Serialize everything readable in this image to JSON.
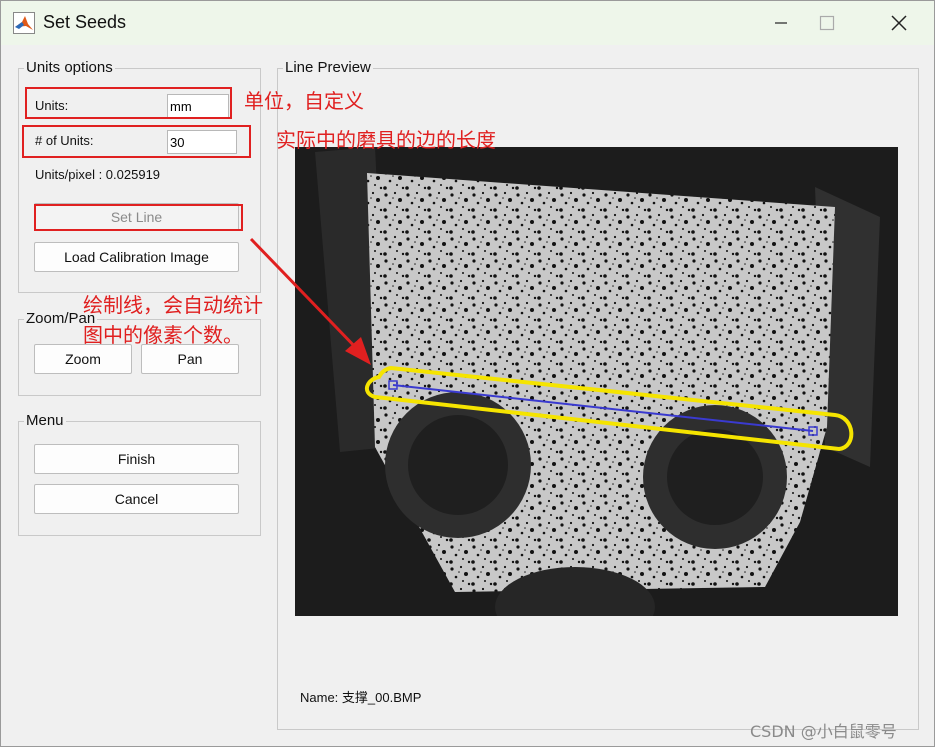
{
  "window": {
    "title": "Set Seeds"
  },
  "units_options": {
    "group_title": "Units options",
    "units_label": "Units:",
    "units_value": "mm",
    "num_units_label": "# of Units:",
    "num_units_value": "30",
    "units_per_pixel": "Units/pixel : 0.025919",
    "set_line_label": "Set Line",
    "load_calibration_label": "Load Calibration Image"
  },
  "zoom_pan": {
    "group_title": "Zoom/Pan",
    "zoom_label": "Zoom",
    "pan_label": "Pan"
  },
  "menu": {
    "group_title": "Menu",
    "finish_label": "Finish",
    "cancel_label": "Cancel"
  },
  "line_preview": {
    "group_title": "Line Preview",
    "name_text": "Name: 支撑_00.BMP"
  },
  "annotations": {
    "units_note": "单位，自定义",
    "length_note": "实际中的磨具的边的长度",
    "line_note_1": "绘制线，会自动统计",
    "line_note_2": "图中的像素个数。"
  },
  "watermark": "CSDN @小白鼠零号",
  "colors": {
    "annotation_red": "#e02020",
    "highlight_yellow": "#f5e400",
    "line_blue": "#3a3ad0"
  }
}
